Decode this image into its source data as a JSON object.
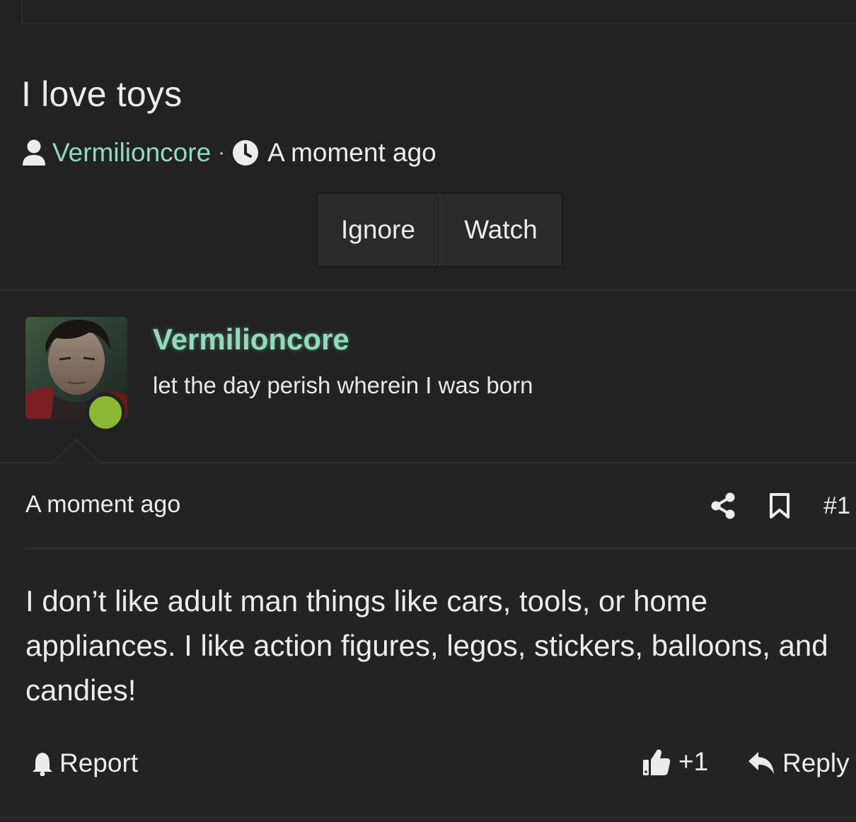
{
  "thread": {
    "title": "I love toys",
    "author": "Vermilioncore",
    "separator": "·",
    "time": "A moment ago"
  },
  "thread_buttons": {
    "ignore_label": "Ignore",
    "watch_label": "Watch"
  },
  "poster": {
    "name": "Vermilioncore",
    "tagline": "let the day perish wherein I was born",
    "online": true
  },
  "post": {
    "time": "A moment ago",
    "number": "#1",
    "body": "I don’t like adult man things like cars, tools, or home appliances. I like action figures, legos, stickers, balloons, and candies!"
  },
  "actions": {
    "report_label": "Report",
    "like_label": "+1",
    "reply_label": "Reply"
  },
  "colors": {
    "background": "#222222",
    "accent_username": "#8fdcbc",
    "online_status": "#8ab834",
    "text": "#ececec"
  },
  "icons": [
    "user-icon",
    "clock-icon",
    "share-icon",
    "bookmark-icon",
    "bell-icon",
    "thumbs-up-icon",
    "reply-icon"
  ]
}
